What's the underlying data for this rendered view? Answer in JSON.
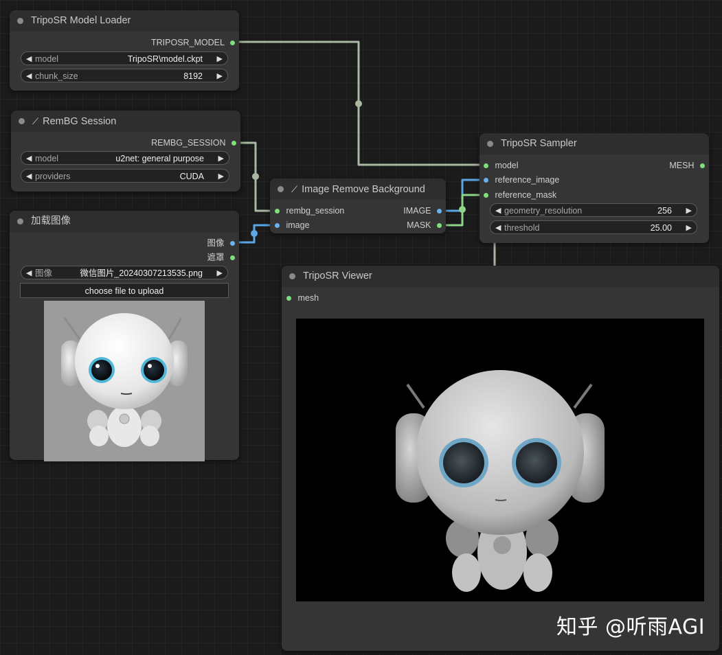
{
  "colors": {
    "canvas_bg": "#1b1b1b",
    "node_bg": "#353535",
    "node_title_bg": "#2e2e2e",
    "wire_default": "#9fb09a",
    "wire_image": "#5ba7e6",
    "wire_mask": "#7ed07a",
    "slot_green": "#7ee07a",
    "slot_blue": "#6ab1f0"
  },
  "loader": {
    "title": "TripoSR Model Loader",
    "output": "TRIPOSR_MODEL",
    "model_label": "model",
    "model_value": "TripoSR\\model.ckpt",
    "chunk_label": "chunk_size",
    "chunk_value": "8192"
  },
  "rembg": {
    "title": "RemBG Session",
    "output": "REMBG_SESSION",
    "model_label": "model",
    "model_value": "u2net: general purpose",
    "providers_label": "providers",
    "providers_value": "CUDA"
  },
  "load_image": {
    "title": "加载图像",
    "output_image": "图像",
    "output_mask": "遮罩",
    "image_label": "图像",
    "image_value": "微信图片_20240307213535.png",
    "upload_label": "choose file to upload"
  },
  "remove_bg": {
    "title": "Image Remove Background",
    "input_session": "rembg_session",
    "input_image": "image",
    "output_image": "IMAGE",
    "output_mask": "MASK"
  },
  "sampler": {
    "title": "TripoSR Sampler",
    "input_model": "model",
    "input_ref_image": "reference_image",
    "input_ref_mask": "reference_mask",
    "output_mesh": "MESH",
    "geo_label": "geometry_resolution",
    "geo_value": "256",
    "thr_label": "threshold",
    "thr_value": "25.00"
  },
  "viewer": {
    "title": "TripoSR Viewer",
    "input_mesh": "mesh"
  },
  "watermark": "知乎 @听雨AGI"
}
